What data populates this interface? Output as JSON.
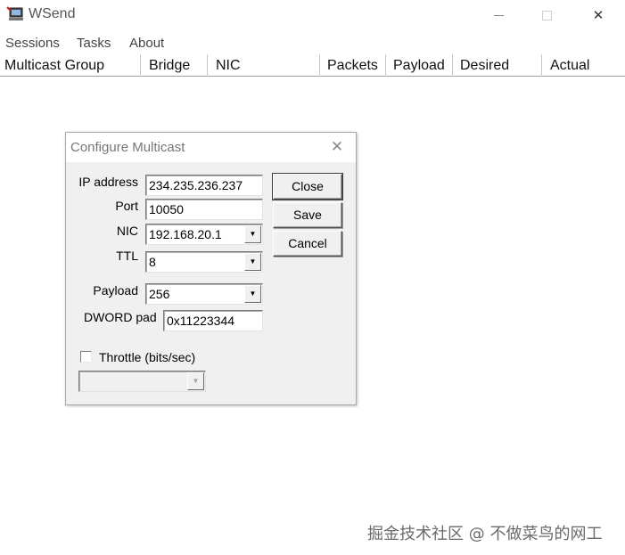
{
  "window": {
    "title": "WSend",
    "minimize_glyph": "—",
    "close_glyph": "✕"
  },
  "menu": [
    "Sessions",
    "Tasks",
    "About"
  ],
  "list_columns": [
    "Multicast Group",
    "Bridge",
    "NIC",
    "Packets",
    "Payload",
    "Desired",
    "Actual"
  ],
  "dialog": {
    "title": "Configure Multicast",
    "close_glyph": "✕",
    "fields": {
      "ip_address": {
        "label": "IP address",
        "value": "234.235.236.237"
      },
      "port": {
        "label": "Port",
        "value": "10050"
      },
      "nic": {
        "label": "NIC",
        "value": "192.168.20.1"
      },
      "ttl": {
        "label": "TTL",
        "value": "8"
      },
      "payload": {
        "label": "Payload",
        "value": "256"
      },
      "dword_pad": {
        "label": "DWORD pad",
        "value": "0x11223344"
      }
    },
    "buttons": {
      "close": "Close",
      "save": "Save",
      "cancel": "Cancel"
    },
    "throttle": {
      "label": "Throttle (bits/sec)",
      "checked": false,
      "value": ""
    },
    "dropdown_glyph": "▼"
  },
  "watermark": "掘金技术社区 @ 不做菜鸟的网工",
  "colors": {
    "window_bg": "#ffffff",
    "dialog_bg": "#f0f0f0",
    "border": "#a8a8a8"
  }
}
